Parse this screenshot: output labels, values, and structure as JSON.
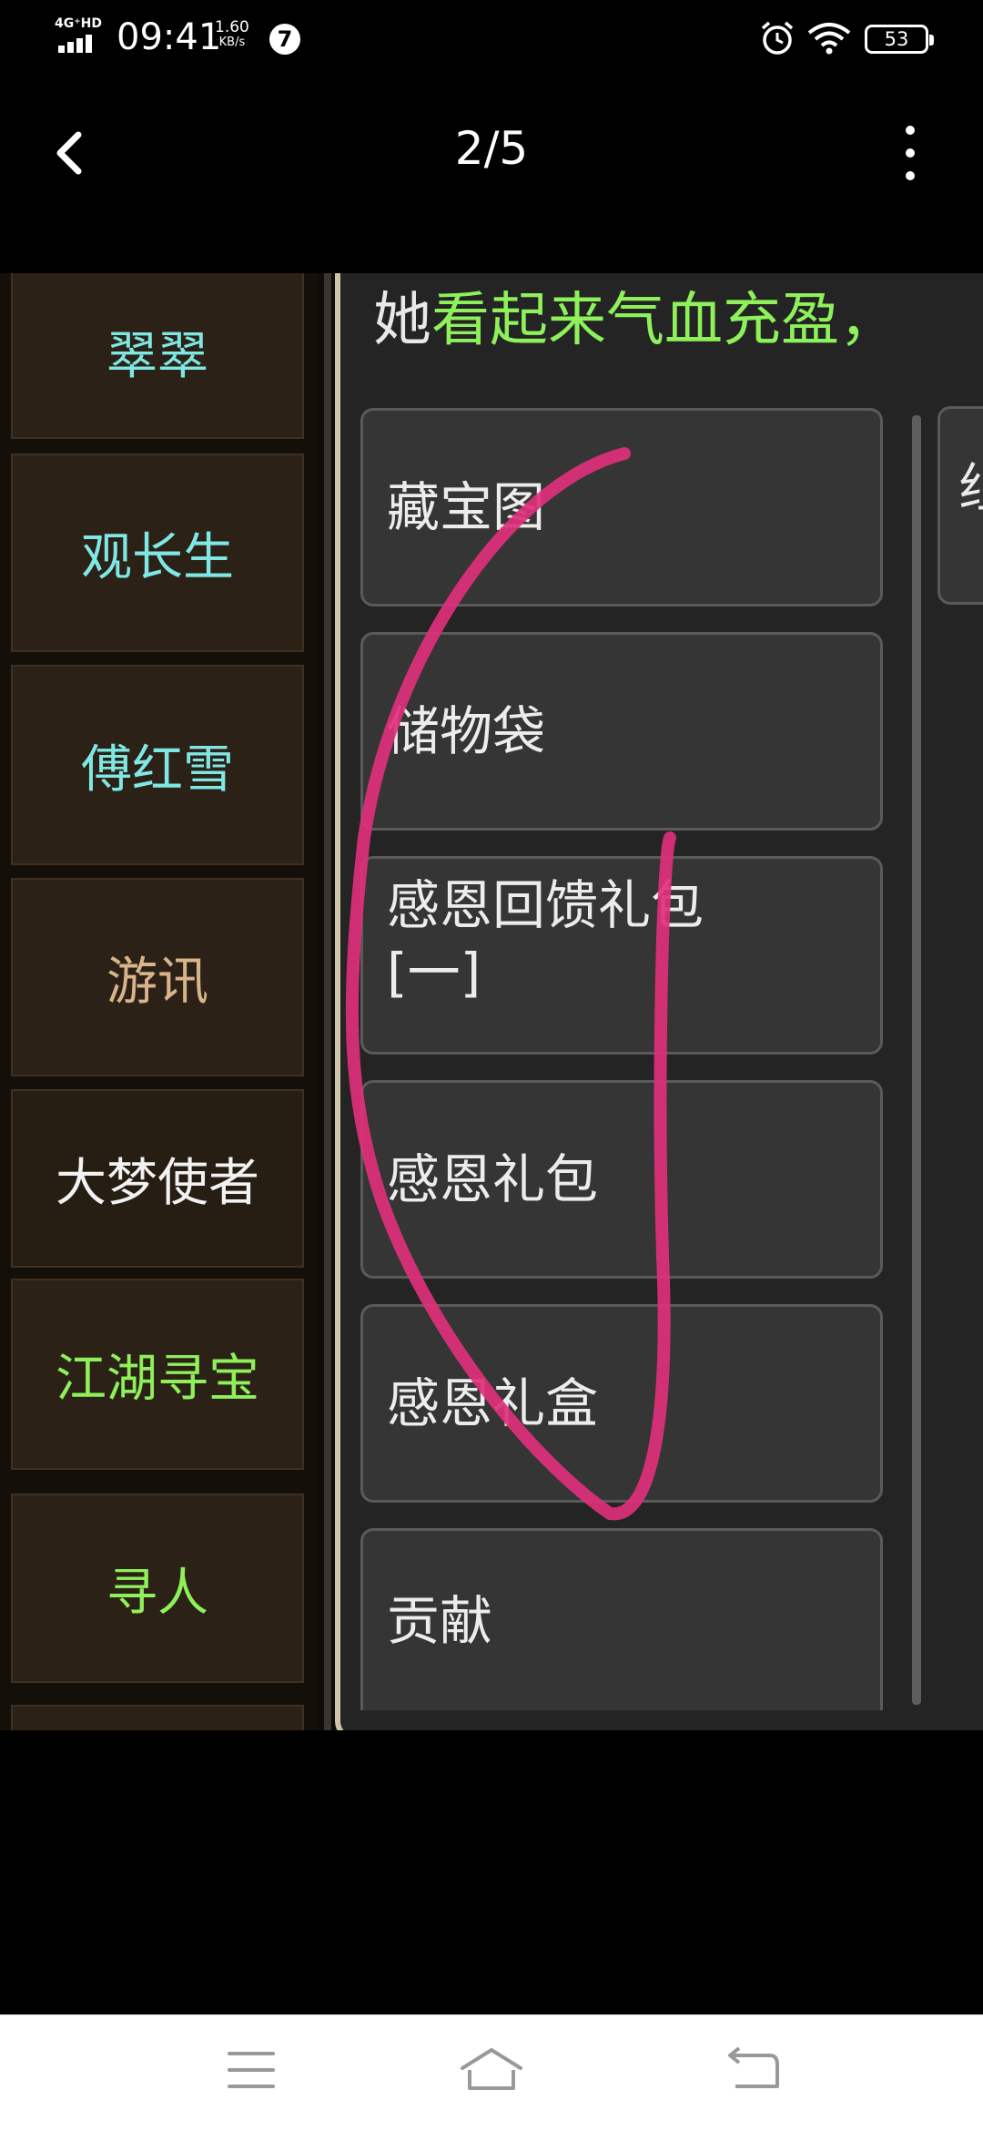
{
  "status_bar": {
    "network": "4G⁺HD",
    "time": "09:41",
    "speed_value": "1.60",
    "speed_unit": "KB/s",
    "notification_count": "7",
    "battery": "53"
  },
  "viewer": {
    "page_counter": "2/5",
    "back_icon": "chevron-left-icon",
    "more_icon": "more-vertical-icon"
  },
  "game": {
    "npc_list": [
      {
        "label": "翠翠",
        "color": "#7fe7e4"
      },
      {
        "label": "观长生",
        "color": "#7fe7e4"
      },
      {
        "label": "傅红雪",
        "color": "#7fe7e4"
      },
      {
        "label": "游讯",
        "color": "#d8b48a"
      },
      {
        "label": "大梦使者",
        "color": "#f2f2f2"
      },
      {
        "label": "江湖寻宝",
        "color": "#8ef05a"
      },
      {
        "label": "寻人",
        "color": "#8ef05a"
      }
    ],
    "status_prefix": "她",
    "status_highlight": "看起来气血充盈，",
    "items": [
      "藏宝图",
      "储物袋",
      "感恩回馈礼包[一]",
      "感恩礼包",
      "感恩礼盒",
      "贡献"
    ],
    "second_column_partial": "组",
    "annotation_color": "#e0307a"
  },
  "nav": {
    "menu_icon": "menu-icon",
    "home_icon": "home-icon",
    "back_icon": "return-icon"
  }
}
